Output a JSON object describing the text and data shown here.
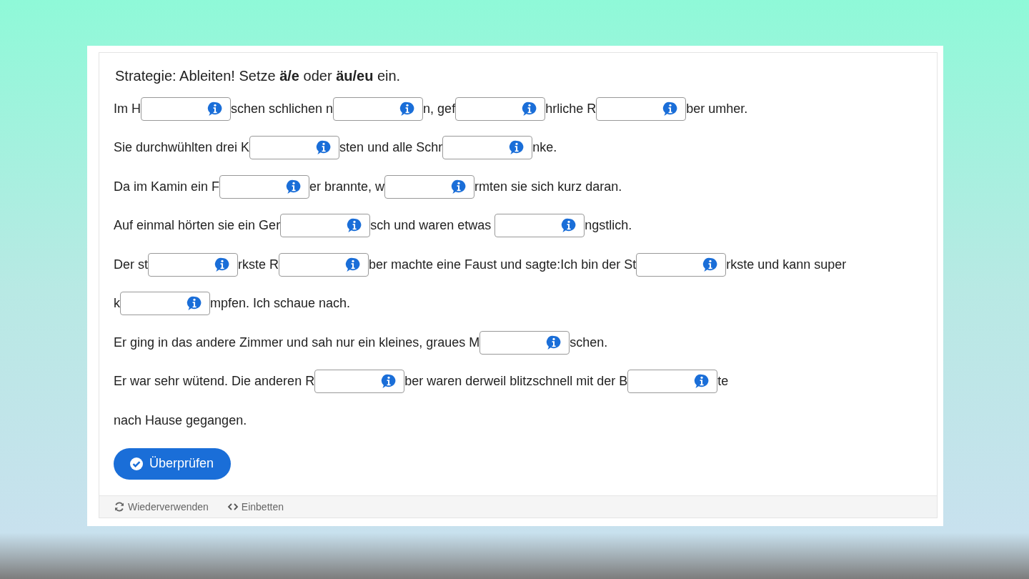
{
  "title": "Strategie: Ableiten! Setze **ä/e** oder **äu/eu** ein.",
  "lines": [
    {
      "segments": [
        {
          "kind": "text",
          "text": "Im H"
        },
        {
          "kind": "blank"
        },
        {
          "kind": "text",
          "text": "schen schlichen n"
        },
        {
          "kind": "blank"
        },
        {
          "kind": "text",
          "text": "n, gef"
        },
        {
          "kind": "blank"
        },
        {
          "kind": "text",
          "text": "hrliche R"
        },
        {
          "kind": "blank"
        },
        {
          "kind": "text",
          "text": "ber umher."
        }
      ]
    },
    {
      "segments": [
        {
          "kind": "text",
          "text": "Sie durchwühlten drei K"
        },
        {
          "kind": "blank"
        },
        {
          "kind": "text",
          "text": "sten und alle Schr"
        },
        {
          "kind": "blank"
        },
        {
          "kind": "text",
          "text": "nke."
        }
      ]
    },
    {
      "segments": [
        {
          "kind": "text",
          "text": "Da im Kamin ein F"
        },
        {
          "kind": "blank"
        },
        {
          "kind": "text",
          "text": "er brannte, w"
        },
        {
          "kind": "blank"
        },
        {
          "kind": "text",
          "text": "rmten sie sich kurz daran."
        }
      ]
    },
    {
      "segments": [
        {
          "kind": "text",
          "text": "Auf einmal hörten sie ein Ger"
        },
        {
          "kind": "blank"
        },
        {
          "kind": "text",
          "text": "sch und waren etwas "
        },
        {
          "kind": "blank"
        },
        {
          "kind": "text",
          "text": "ngstlich."
        }
      ]
    },
    {
      "segments": [
        {
          "kind": "text",
          "text": "Der st"
        },
        {
          "kind": "blank"
        },
        {
          "kind": "text",
          "text": "rkste R"
        },
        {
          "kind": "blank"
        },
        {
          "kind": "text",
          "text": "ber machte eine Faust und sagte:Ich bin der St"
        },
        {
          "kind": "blank"
        },
        {
          "kind": "text",
          "text": "rkste und kann super"
        }
      ]
    },
    {
      "segments": [
        {
          "kind": "text",
          "text": "k"
        },
        {
          "kind": "blank"
        },
        {
          "kind": "text",
          "text": "mpfen. Ich schaue nach."
        }
      ]
    },
    {
      "segments": [
        {
          "kind": "text",
          "text": "Er ging in das andere Zimmer und sah nur ein kleines, graues M"
        },
        {
          "kind": "blank"
        },
        {
          "kind": "text",
          "text": "schen."
        }
      ]
    },
    {
      "segments": [
        {
          "kind": "text",
          "text": "Er war sehr wütend. Die anderen R"
        },
        {
          "kind": "blank"
        },
        {
          "kind": "text",
          "text": "ber waren derweil blitzschnell mit der B"
        },
        {
          "kind": "blank"
        },
        {
          "kind": "text",
          "text": "te"
        }
      ]
    },
    {
      "segments": [
        {
          "kind": "text",
          "text": "nach Hause gegangen."
        }
      ]
    }
  ],
  "check_button": "Überprüfen",
  "footer": [
    {
      "kind": "reuse",
      "label": "Wiederverwenden"
    },
    {
      "kind": "embed",
      "label": "Einbetten"
    }
  ]
}
